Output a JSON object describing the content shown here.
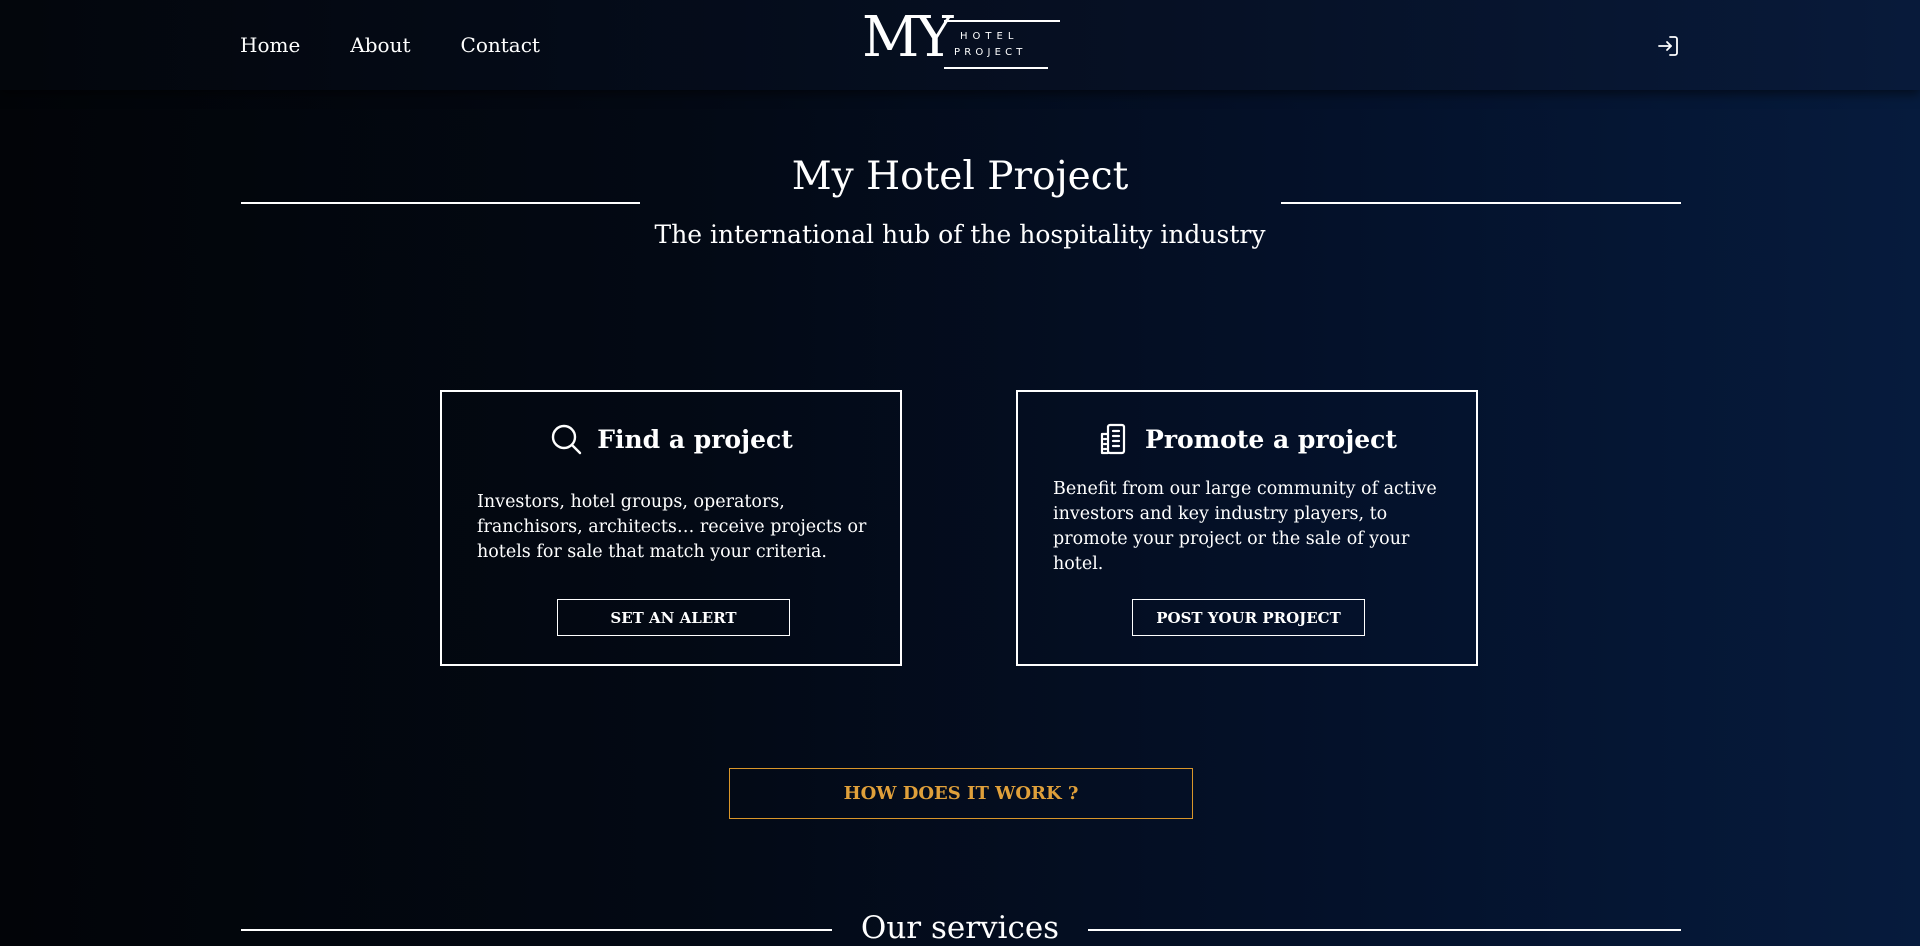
{
  "nav": {
    "items": [
      {
        "label": "Home"
      },
      {
        "label": "About"
      },
      {
        "label": "Contact"
      }
    ]
  },
  "logo": {
    "mark": "MY",
    "line1": "HOTEL",
    "line2": "PROJECT"
  },
  "header": {
    "login_icon": "sign-in-icon"
  },
  "hero": {
    "title": "My Hotel Project",
    "subtitle": "The international hub of the hospitality industry"
  },
  "cards": [
    {
      "icon": "search-icon",
      "title": "Find a project",
      "text": "Investors, hotel groups, operators, franchisors, architects… receive projects or hotels for sale that match your criteria.",
      "button": "SET AN ALERT"
    },
    {
      "icon": "building-icon",
      "title": "Promote a project",
      "text": "Benefit from our large community of active investors and key industry players, to promote your project or the sale of your hotel.",
      "button": "POST YOUR PROJECT"
    }
  ],
  "how": {
    "label": "HOW DOES IT WORK ?",
    "color": "#d9962a"
  },
  "services": {
    "title": "Our services"
  }
}
